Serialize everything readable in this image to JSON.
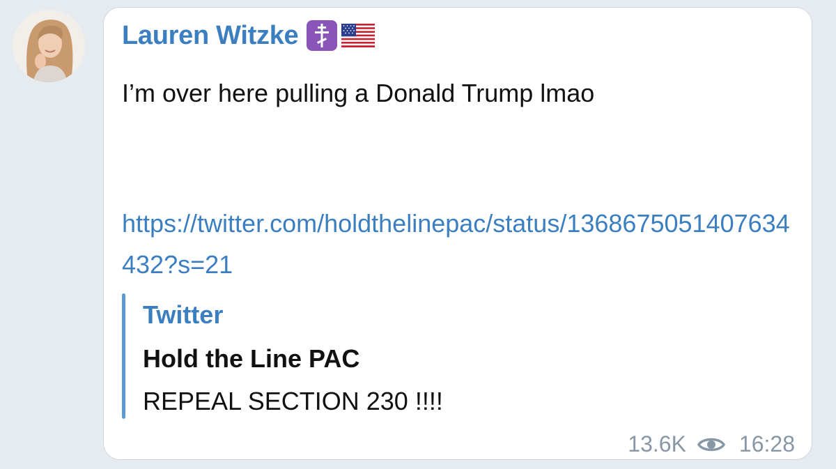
{
  "author": {
    "name": "Lauren Witzke"
  },
  "icons": {
    "avatar": "profile-photo-avatar",
    "badge": "orthodox-cross-icon",
    "flag": "us-flag-icon",
    "views": "eye-icon"
  },
  "message": {
    "text": "I’m over here pulling a Donald Trump lmao",
    "link": "https://twitter.com/holdthelinepac/status/1368675051407634432?s=21"
  },
  "link_preview": {
    "site_name": "Twitter",
    "title": "Hold the Line PAC",
    "description": "REPEAL SECTION 230 !!!!"
  },
  "meta": {
    "views": "13.6K",
    "time": "16:28"
  },
  "colors": {
    "background": "#e6ebf0",
    "bubble": "#ffffff",
    "accent": "#3b7fc0",
    "preview_bar": "#5a9bd5",
    "meta_text": "#8897a6",
    "badge": "#8a55b8"
  }
}
